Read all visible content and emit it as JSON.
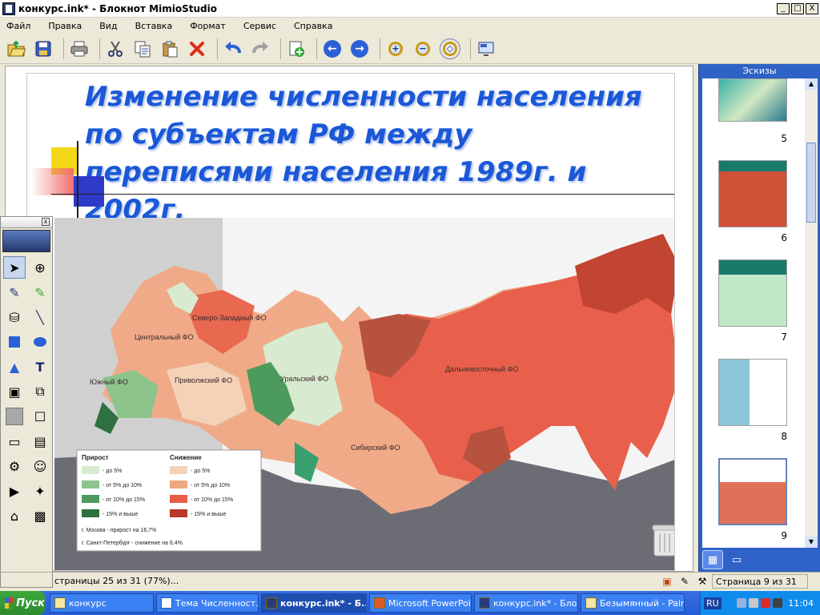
{
  "window": {
    "title": "конкурс.ink* - Блокнот MimioStudio",
    "btn_min": "_",
    "btn_max": "□",
    "btn_close": "X"
  },
  "menu": [
    "Файл",
    "Правка",
    "Вид",
    "Вставка",
    "Формат",
    "Сервис",
    "Справка"
  ],
  "toolbar": {
    "icons": [
      "open-icon",
      "save-icon",
      "print-icon",
      "cut-icon",
      "copy-icon",
      "paste-icon",
      "delete-icon",
      "undo-icon",
      "redo-icon",
      "add-page-icon",
      "previous-page-icon",
      "next-page-icon",
      "zoom-in-icon",
      "zoom-out-icon",
      "zoom-fit-icon",
      "display-icon"
    ]
  },
  "slide": {
    "title": "Изменение численности населения по субъектам РФ между переписями населения 1989г. и 2002г.",
    "map": {
      "districts": [
        "Северо-Западный ФО",
        "Центральный ФО",
        "Южный ФО",
        "Приволжский ФО",
        "Уральский ФО",
        "Сибирский ФО",
        "Дальневосточный ФО"
      ],
      "legend": {
        "growth_title": "Прирост",
        "decline_title": "Снижение",
        "growth": [
          "- до 5%",
          "- от 5% до 10%",
          "- от 10% до 15%",
          "- 15% и выше"
        ],
        "decline": [
          "- до 5%",
          "- от 5% до 10%",
          "- от 10% до 15%",
          "- 15% и выше"
        ],
        "notes": [
          "г. Москва - прирост на 16,7%",
          "г. Санкт-Петербург - снижение на 6,4%"
        ],
        "growth_colors": [
          "#d8ead0",
          "#8cc48c",
          "#4c9a5c",
          "#2e7040"
        ],
        "decline_colors": [
          "#f4d2b8",
          "#f0a882",
          "#e85c48",
          "#b83828"
        ]
      }
    }
  },
  "palette": {
    "close": "x",
    "tools": [
      "select-icon",
      "zoom-icon",
      "pen-icon",
      "highlighter-icon",
      "cylinder-icon",
      "line-icon",
      "rectangle-icon",
      "ellipse-icon",
      "triangle-icon",
      "text-icon",
      "image-icon",
      "screenshot-icon",
      "color-icon",
      "line-width-icon",
      "fill-icon",
      "gallery-icon",
      "record-icon",
      "magic-icon",
      "mouse-icon",
      "screen-icon",
      "recognize-icon",
      "export-icon"
    ]
  },
  "status": {
    "progress": "страницы 25 из 31 (77%)...",
    "page": "Страница 9 из 31"
  },
  "thumbs": {
    "header": "Эскизы",
    "items": [
      {
        "num": "5"
      },
      {
        "num": "6"
      },
      {
        "num": "7"
      },
      {
        "num": "8"
      },
      {
        "num": "9"
      }
    ]
  },
  "taskbar": {
    "start": "Пуск",
    "tasks": [
      "конкурс",
      "Тема Численност...",
      "конкурс.ink* - Б...",
      "Microsoft PowerPoi...",
      "конкурс.ink* - Бло...",
      "Безымянный - Paint"
    ],
    "lang": "RU",
    "clock": "11:04"
  }
}
